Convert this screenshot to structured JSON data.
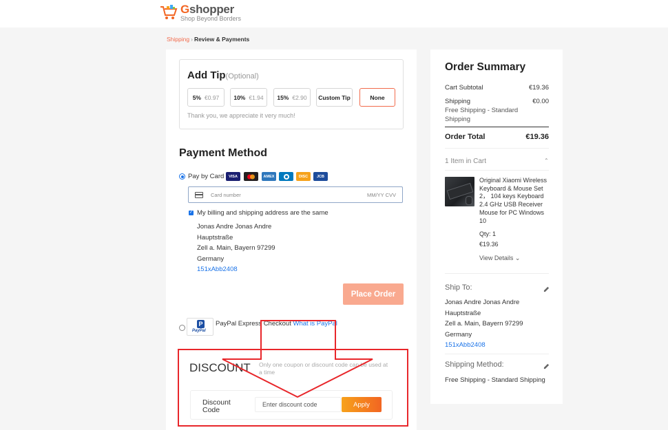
{
  "brand": {
    "name_first": "G",
    "name_rest": "shopper",
    "tagline": "Shop Beyond Borders"
  },
  "breadcrumb": {
    "link": "Shipping",
    "separator": "›",
    "current": "Review & Payments"
  },
  "tip": {
    "title": "Add Tip",
    "optional": "(Optional)",
    "options": [
      {
        "percent": "5%",
        "amount": "€0.97"
      },
      {
        "percent": "10%",
        "amount": "€1.94"
      },
      {
        "percent": "15%",
        "amount": "€2.90"
      }
    ],
    "custom_label": "Custom Tip",
    "none_label": "None",
    "selected": "None",
    "thanks": "Thank you, we appreciate it very much!"
  },
  "payment": {
    "title": "Payment Method",
    "pay_by_card": "Pay by Card",
    "card_brands": [
      {
        "name": "visa-icon",
        "label": "VISA",
        "color": "#1a1f71"
      },
      {
        "name": "mastercard-icon",
        "label": "",
        "color": "#231f20"
      },
      {
        "name": "amex-icon",
        "label": "AMEX",
        "color": "#2e77bc"
      },
      {
        "name": "diners-icon",
        "label": "",
        "color": "#0079be"
      },
      {
        "name": "discover-icon",
        "label": "DISC",
        "color": "#f6a21b"
      },
      {
        "name": "jcb-icon",
        "label": "JCB",
        "color": "#1d4c9b"
      }
    ],
    "card_number_placeholder": "Card number",
    "card_expiry_placeholder": "MM/YY  CVV",
    "same_address_label": "My billing and shipping address are the same",
    "billing_address": [
      "Jonas Andre Jonas Andre",
      "Hauptstraße",
      "Zell a. Main, Bayern 97299",
      "Germany"
    ],
    "billing_phone": "151xAbb2408",
    "place_order": "Place Order",
    "paypal_logo_text": "PayPal",
    "paypal_label": "PayPal Express Checkout",
    "paypal_link": "What is PayPal"
  },
  "discount": {
    "title": "DISCOUNT",
    "note": "Only one coupon or discount code can be used at a time",
    "label": "Discount Code",
    "placeholder": "Enter discount code",
    "apply": "Apply"
  },
  "summary": {
    "title": "Order Summary",
    "subtotal_label": "Cart Subtotal",
    "subtotal_value": "€19.36",
    "shipping_label": "Shipping",
    "shipping_value": "€0.00",
    "shipping_method_note": "Free Shipping - Standard Shipping",
    "total_label": "Order Total",
    "total_value": "€19.36",
    "items_label": "1 Item in Cart",
    "item": {
      "name": "Original Xiaomi Wireless Keyboard & Mouse Set 2， 104 keys Keyboard 2.4 GHz USB Receiver Mouse for PC Windows 10",
      "qty": "Qty: 1",
      "price": "€19.36",
      "view_details": "View Details ⌄"
    },
    "ship_to_title": "Ship To:",
    "ship_to": [
      "Jonas Andre Jonas Andre",
      "Hauptstraße",
      "Zell a. Main, Bayern 97299",
      "Germany"
    ],
    "ship_to_phone": "151xAbb2408",
    "shipping_method_title": "Shipping Method:",
    "shipping_method_value": "Free Shipping - Standard Shipping"
  },
  "colors": {
    "accent": "#f26a4b",
    "link": "#1a73e8",
    "annotation_red": "#e8262a"
  }
}
